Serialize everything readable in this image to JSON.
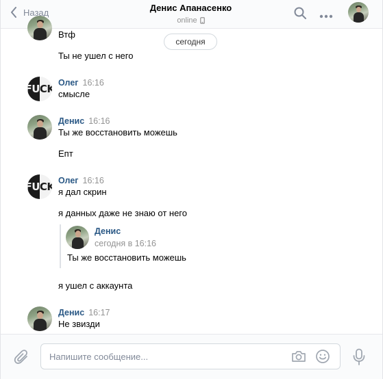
{
  "header": {
    "back_label": "Назад",
    "title": "Денис Апанасенко",
    "status": "online",
    "status_device_icon": "mobile-phone-icon",
    "icons": [
      "search-icon",
      "more-icon"
    ]
  },
  "date_divider": "сегодня",
  "messages": [
    {
      "author": "",
      "time": "",
      "avatar": "denis",
      "lines": [
        "Втф",
        "Ты не ушел с него"
      ]
    },
    {
      "author": "Олег",
      "time": "16:16",
      "avatar": "oleg",
      "lines": [
        "смысле"
      ]
    },
    {
      "author": "Денис",
      "time": "16:16",
      "avatar": "denis",
      "lines": [
        "Ты же восстановить можешь",
        "Епт"
      ]
    },
    {
      "author": "Олег",
      "time": "16:16",
      "avatar": "oleg",
      "lines": [
        "я дал скрин",
        "я данных даже не знаю от него"
      ]
    },
    {
      "author": "",
      "time": "",
      "avatar": "",
      "lines": [
        "я ушел с аккаунта"
      ]
    },
    {
      "author": "Денис",
      "time": "16:17",
      "avatar": "denis",
      "lines": [
        "Не звизди"
      ]
    }
  ],
  "forwarded": {
    "author": "Денис",
    "time": "сегодня в 16:16",
    "text": "Ты же восстановить можешь"
  },
  "avatar_text": "FUCK",
  "compose": {
    "placeholder": "Напишите сообщение...",
    "icons": [
      "paperclip-icon",
      "camera-icon",
      "smile-icon",
      "microphone-icon"
    ]
  },
  "colors": {
    "link": "#2a5885",
    "muted": "#939393",
    "icon": "#828a99"
  }
}
